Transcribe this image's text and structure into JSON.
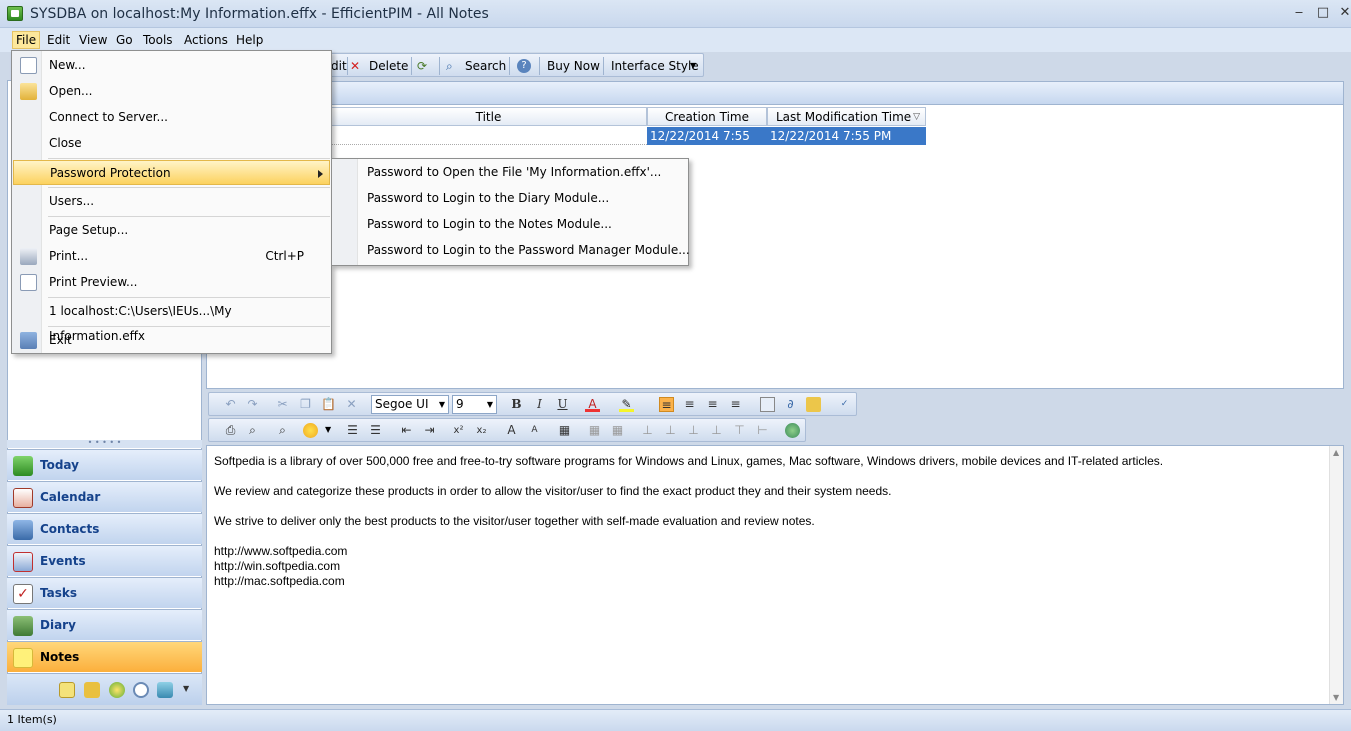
{
  "window": {
    "title": "SYSDBA on localhost:My Information.effx - EfficientPIM - All Notes",
    "minimize": "‒",
    "maximize": "□",
    "close": "✕"
  },
  "menubar": [
    "File",
    "Edit",
    "View",
    "Go",
    "Tools",
    "Actions",
    "Help"
  ],
  "toolbar": {
    "edit_label": "dit",
    "delete_label": "Delete",
    "search_label": "Search",
    "buy_label": "Buy Now",
    "style_label": "Interface Style"
  },
  "file_menu": {
    "new": "New...",
    "open": "Open...",
    "connect": "Connect to Server...",
    "close": "Close",
    "password": "Password Protection",
    "users": "Users...",
    "page_setup": "Page Setup...",
    "print": "Print...",
    "print_shortcut": "Ctrl+P",
    "print_preview": "Print Preview...",
    "recent": "1 localhost:C:\\Users\\IEUs...\\My Information.effx",
    "exit": "Exit"
  },
  "password_submenu": [
    "Password to Open the File 'My Information.effx'...",
    "Password to Login to the Diary Module...",
    "Password to Login to the Notes Module...",
    "Password to Login to the Password Manager Module..."
  ],
  "table": {
    "columns": [
      "Title",
      "Creation Time",
      "Last Modification Time"
    ],
    "rows": [
      {
        "title": "",
        "created": "12/22/2014 7:55 PM",
        "modified": "12/22/2014 7:55 PM"
      }
    ]
  },
  "format_bar": {
    "font": "Segoe UI",
    "size": "9"
  },
  "nav": [
    "Today",
    "Calendar",
    "Contacts",
    "Events",
    "Tasks",
    "Diary",
    "Notes"
  ],
  "active_nav": "Notes",
  "editor_lines": [
    "Softpedia is a library of over 500,000 free and free-to-try software programs for Windows and Linux, games, Mac software, Windows drivers, mobile devices and IT-related articles.",
    "We review and categorize these products in order to allow the visitor/user to find the exact product they and their system needs.",
    "We strive to deliver only the best products to the visitor/user together with self-made evaluation and review notes.",
    "http://www.softpedia.com",
    "http://win.softpedia.com",
    "http://mac.softpedia.com"
  ],
  "status": "1 Item(s)",
  "colors": {
    "accent": "#fbaf3c",
    "selection": "#3a78c8",
    "nav_text": "#15428b"
  }
}
